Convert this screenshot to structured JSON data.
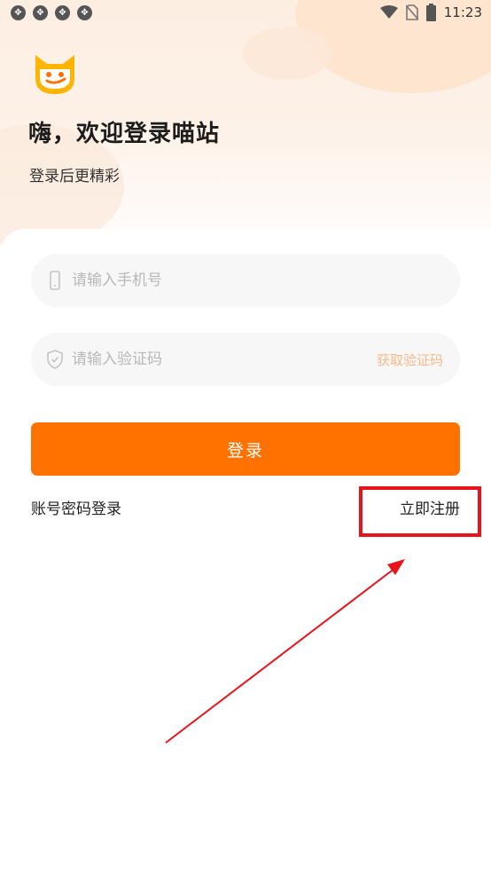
{
  "status_bar": {
    "time": "11:23",
    "notification_icons": [
      "notification-icon",
      "notification-icon",
      "notification-icon",
      "notification-icon"
    ],
    "right_icons": [
      "wifi-icon",
      "no-sim-icon",
      "battery-icon"
    ]
  },
  "header": {
    "logo_icon": "cat-logo-icon",
    "title": "嗨，欢迎登录喵站",
    "subtitle": "登录后更精彩"
  },
  "form": {
    "phone": {
      "placeholder": "请输入手机号",
      "value": "",
      "icon": "phone-icon"
    },
    "code": {
      "placeholder": "请输入验证码",
      "value": "",
      "icon": "shield-icon",
      "get_code_label": "获取验证码"
    },
    "login_label": "登录",
    "password_login_label": "账号密码登录",
    "register_label": "立即注册"
  },
  "colors": {
    "accent": "#ff7200",
    "get_code": "#f5b98a",
    "annotation": "#e8141b",
    "header_bg": "#fdeee2"
  }
}
